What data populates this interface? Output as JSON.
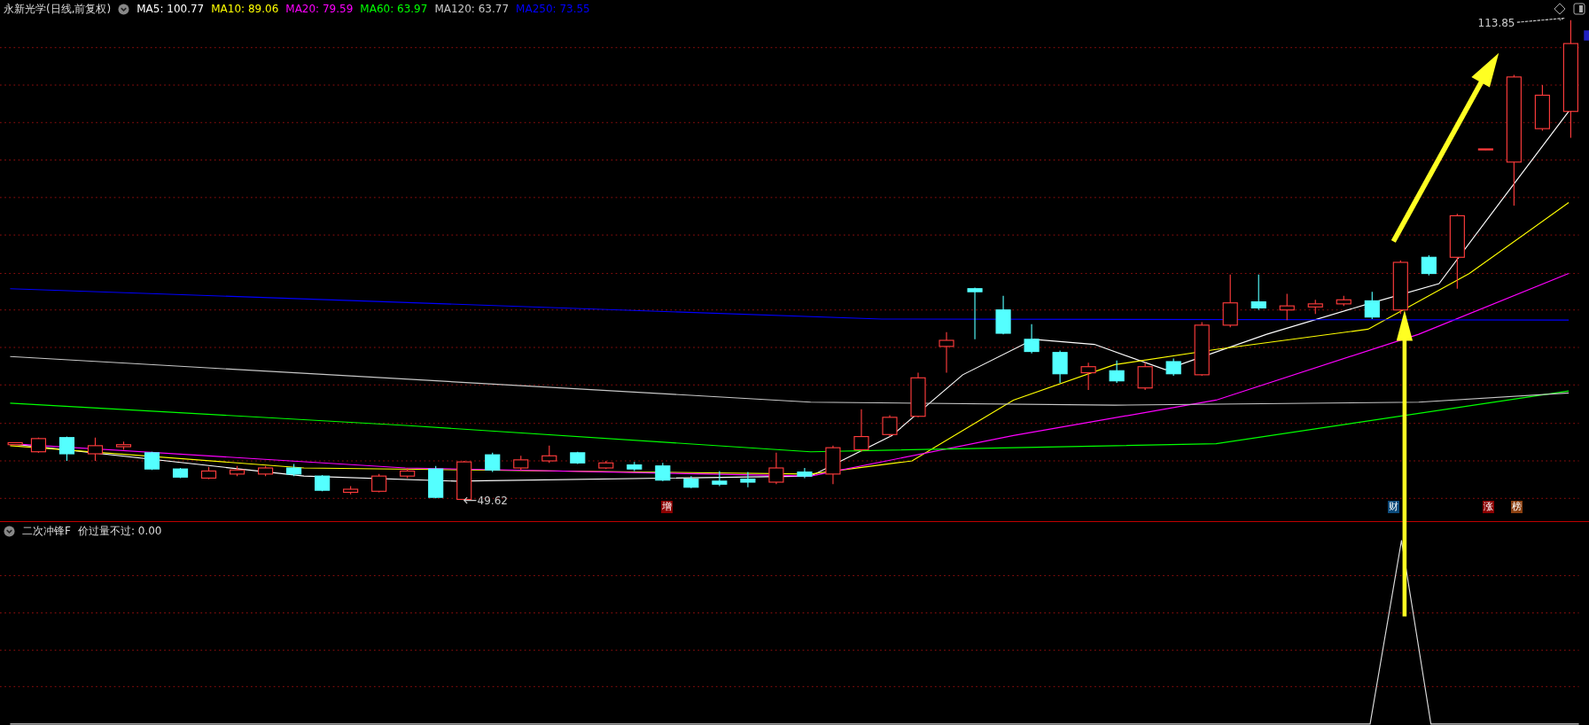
{
  "header": {
    "title": "永新光学(日线,前复权)",
    "ma_legend": [
      {
        "label": "MA5: 100.77",
        "color": "#ffffff"
      },
      {
        "label": "MA10: 89.06",
        "color": "#ffff00"
      },
      {
        "label": "MA20: 79.59",
        "color": "#ff00ff"
      },
      {
        "label": "MA60: 63.97",
        "color": "#00ff00"
      },
      {
        "label": "MA120: 63.77",
        "color": "#c8c8c8"
      },
      {
        "label": "MA250: 73.55",
        "color": "#0000ff"
      }
    ]
  },
  "main_chart": {
    "high_label": "113.85",
    "low_label": "49.62",
    "signals": [
      {
        "label": "增",
        "color": "#8b0000"
      },
      {
        "label": "财",
        "color": "#0b4a7a"
      },
      {
        "label": "涨",
        "color": "#8b0000"
      },
      {
        "label": "榜",
        "color": "#8b4010"
      }
    ]
  },
  "indicator": {
    "name": "二次冲锋F",
    "reading": "价过量不过: 0.00"
  }
}
